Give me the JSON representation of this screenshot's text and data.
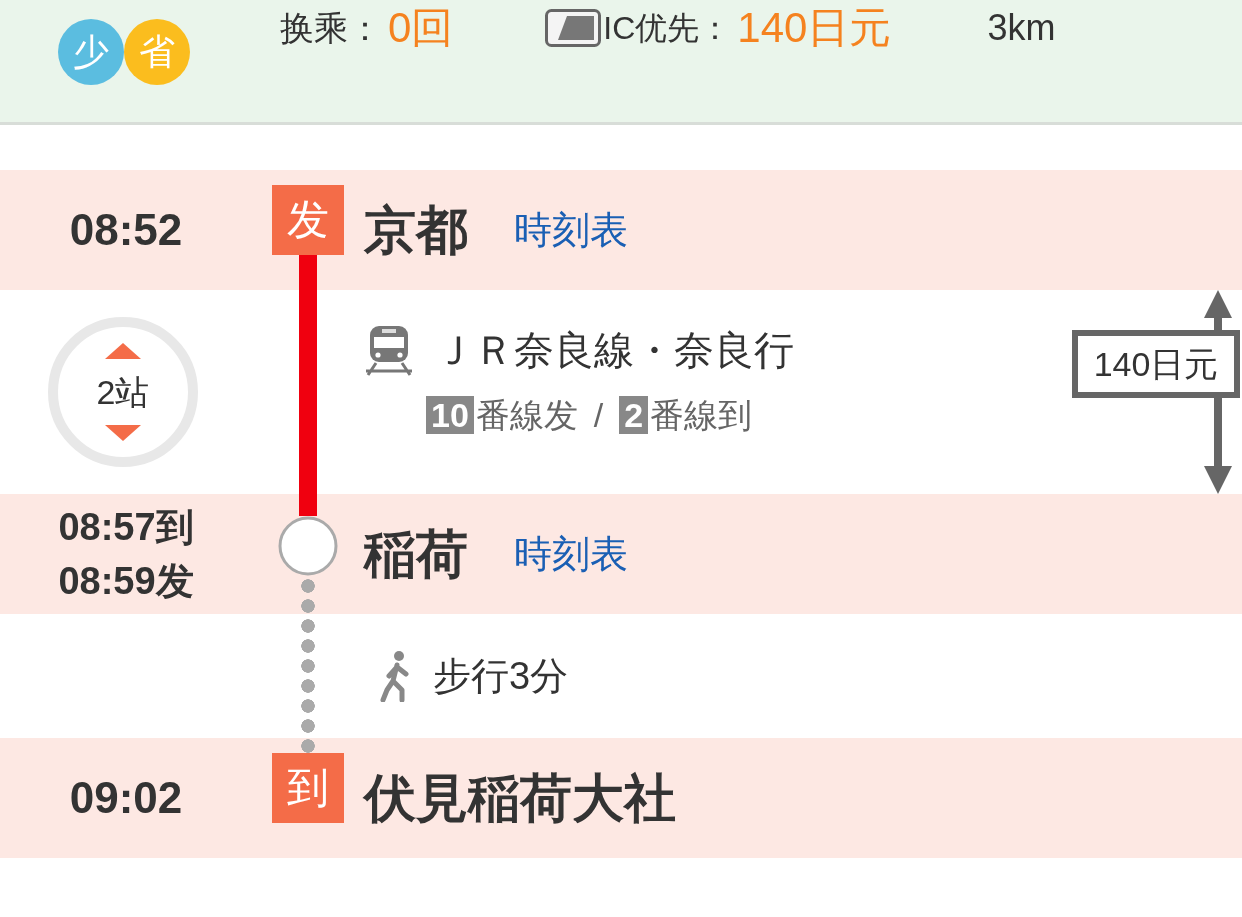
{
  "summary": {
    "tags": [
      {
        "text": "少",
        "color": "#5bbde0"
      },
      {
        "text": "省",
        "color": "#fbbd1e"
      }
    ],
    "transfers": {
      "label": "换乘：",
      "value": "0回"
    },
    "fare": {
      "label": "IC优先：",
      "value": "140日元"
    },
    "distance": "3km"
  },
  "route": [
    {
      "kind": "station",
      "times": [
        "08:52"
      ],
      "marker": "发",
      "name": "京都",
      "link": "時刻表"
    },
    {
      "kind": "ride",
      "stops": "2站",
      "line": "ＪＲ奈良線・奈良行",
      "departure": {
        "number": "10",
        "label": "番線发"
      },
      "separator": "/",
      "arrival": {
        "number": "2",
        "label": "番線到"
      },
      "fare": "140日元"
    },
    {
      "kind": "station",
      "times": [
        "08:57到",
        "08:59发"
      ],
      "name": "稲荷",
      "link": "時刻表"
    },
    {
      "kind": "walk",
      "text": "步行3分"
    },
    {
      "kind": "station",
      "times": [
        "09:02"
      ],
      "marker": "到",
      "name": "伏見稲荷大社"
    }
  ]
}
